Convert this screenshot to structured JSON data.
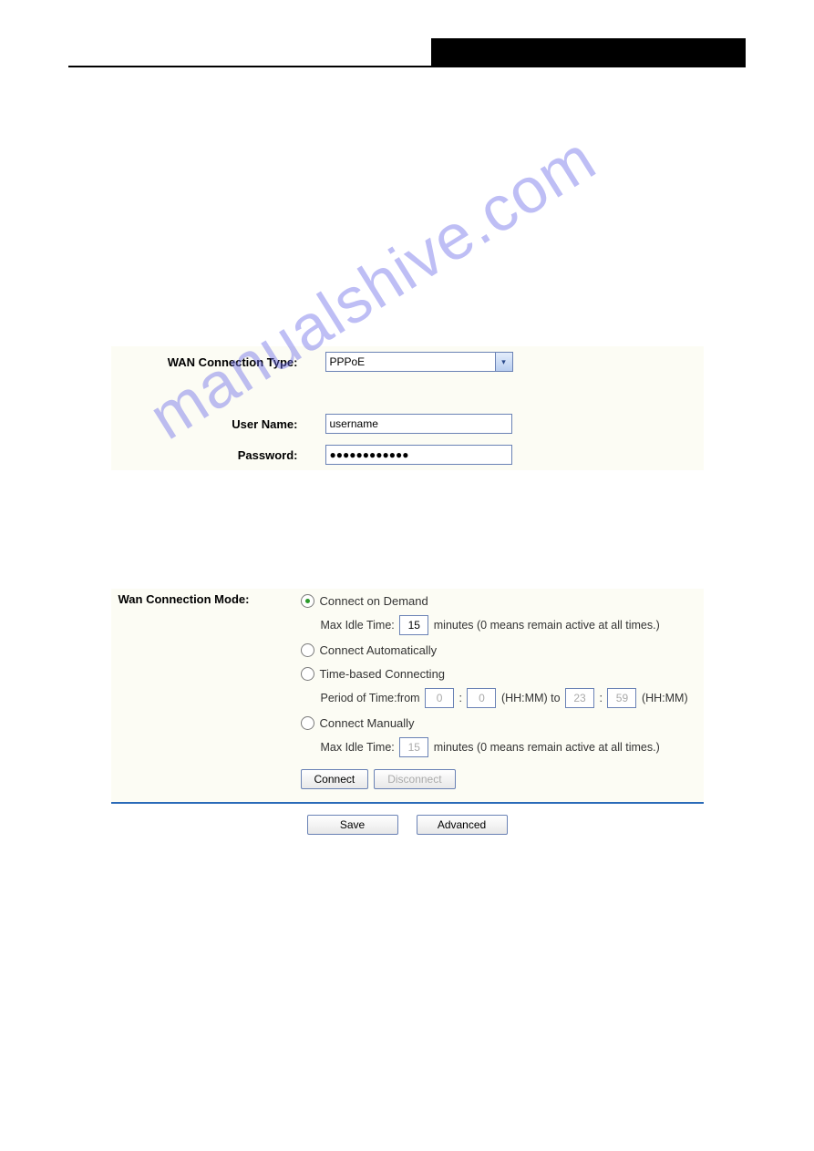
{
  "watermark": "manualshive.com",
  "wan_type": {
    "label": "WAN Connection Type:",
    "value": "PPPoE"
  },
  "username": {
    "label": "User Name:",
    "value": "username"
  },
  "password": {
    "label": "Password:",
    "value": "●●●●●●●●●●●●"
  },
  "mode": {
    "label": "Wan Connection Mode:",
    "opt_demand": "Connect on Demand",
    "demand_idle_prefix": "Max Idle Time:",
    "demand_idle_value": "15",
    "demand_idle_suffix": "minutes (0 means remain active at all times.)",
    "opt_auto": "Connect Automatically",
    "opt_time": "Time-based Connecting",
    "time_prefix": "Period of Time:from",
    "time_from_h": "0",
    "time_from_m": "0",
    "time_mid1": "(HH:MM) to",
    "time_to_h": "23",
    "time_to_m": "59",
    "time_mid2": "(HH:MM)",
    "opt_manual": "Connect Manually",
    "manual_idle_prefix": "Max Idle Time:",
    "manual_idle_value": "15",
    "manual_idle_suffix": "minutes (0 means remain active at all times.)"
  },
  "buttons": {
    "connect": "Connect",
    "disconnect": "Disconnect",
    "save": "Save",
    "advanced": "Advanced"
  }
}
